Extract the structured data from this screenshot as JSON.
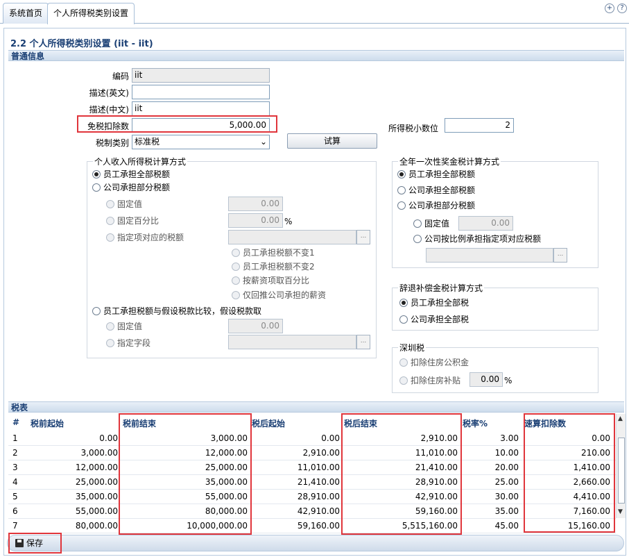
{
  "tabs": [
    {
      "label": "系统首页"
    },
    {
      "label": "个人所得税类别设置"
    }
  ],
  "page_title": "2.2 个人所得税类别设置 (iit - iit)",
  "general_section": "普通信息",
  "form": {
    "code_label": "编码",
    "code_value": "iit",
    "desc_en_label": "描述(英文)",
    "desc_en_value": "",
    "desc_cn_label": "描述(中文)",
    "desc_cn_value": "iit",
    "exemption_label": "免税扣除数",
    "exemption_value": "5,000.00",
    "tax_type_label": "税制类别",
    "tax_type_value": "标准税",
    "decimal_label": "所得税小数位",
    "decimal_value": "2",
    "trial_button": "试算"
  },
  "income_group": {
    "legend": "个人收入所得税计算方式",
    "opt1": "员工承担全部税额",
    "opt2": "公司承担部分税额",
    "fixed_label": "固定值",
    "fixed_value": "0.00",
    "pct_label": "固定百分比",
    "pct_value": "0.00",
    "pct_unit": "%",
    "item_label": "指定项对应的税额",
    "browse": "...",
    "sub1": "员工承担税额不变1",
    "sub2": "员工承担税额不变2",
    "sub3": "按薪资项取百分比",
    "sub4": "仅回推公司承担的薪资",
    "opt3": "员工承担税额与假设税款比较，假设税款取",
    "fixed2_label": "固定值",
    "fixed2_value": "0.00",
    "field_label": "指定字段"
  },
  "bonus_group": {
    "legend": "全年一次性奖金税计算方式",
    "opt1": "员工承担全部税额",
    "opt2": "公司承担全部税额",
    "opt3": "公司承担部分税额",
    "fixed_label": "固定值",
    "fixed_value": "0.00",
    "ratio_label": "公司按比例承担指定项对应税额",
    "browse": "..."
  },
  "severance_group": {
    "legend": "辞退补偿金税计算方式",
    "opt1": "员工承担全部税",
    "opt2": "公司承担全部税"
  },
  "shenzhen_group": {
    "legend": "深圳税",
    "opt1": "扣除住房公积金",
    "opt2": "扣除住房补贴",
    "subsidy_value": "0.00",
    "subsidy_unit": "%"
  },
  "tax_table": {
    "section_label": "税表",
    "headers": [
      "#",
      "税前起始",
      "税前结束",
      "税后起始",
      "税后结束",
      "税率%",
      "速算扣除数"
    ],
    "rows": [
      [
        "1",
        "0.00",
        "3,000.00",
        "0.00",
        "2,910.00",
        "3.00",
        "0.00"
      ],
      [
        "2",
        "3,000.00",
        "12,000.00",
        "2,910.00",
        "11,010.00",
        "10.00",
        "210.00"
      ],
      [
        "3",
        "12,000.00",
        "25,000.00",
        "11,010.00",
        "21,410.00",
        "20.00",
        "1,410.00"
      ],
      [
        "4",
        "25,000.00",
        "35,000.00",
        "21,410.00",
        "28,910.00",
        "25.00",
        "2,660.00"
      ],
      [
        "5",
        "35,000.00",
        "55,000.00",
        "28,910.00",
        "42,910.00",
        "30.00",
        "4,410.00"
      ],
      [
        "6",
        "55,000.00",
        "80,000.00",
        "42,910.00",
        "59,160.00",
        "35.00",
        "7,160.00"
      ],
      [
        "7",
        "80,000.00",
        "10,000,000.00",
        "59,160.00",
        "5,515,160.00",
        "45.00",
        "15,160.00"
      ]
    ]
  },
  "save_button": "保存",
  "colors": {
    "accent": "#1a3f74",
    "highlight": "#e0353b"
  }
}
